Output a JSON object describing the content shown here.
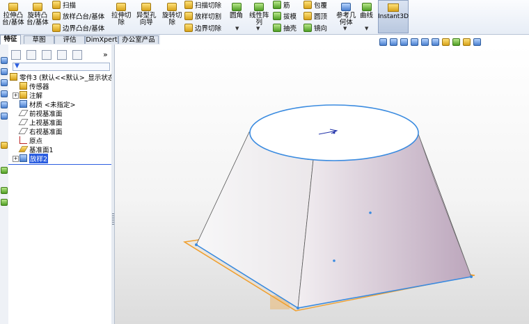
{
  "ribbon": {
    "extrude_boss": "拉伸凸\n台/基体",
    "revolve_boss": "旋转凸\n台/基体",
    "sweep": "扫描",
    "loft_boss": "放样凸台/基体",
    "boundary_boss": "边界凸台/基体",
    "extrude_cut": "拉伸切\n除",
    "hole_wizard": "异型孔\n向导",
    "revolve_cut": "旋转切\n除",
    "swept_cut": "扫描切除",
    "lofted_cut": "放样切割",
    "boundary_cut": "边界切除",
    "fillet": "圆角",
    "linear_pattern": "线性阵\n列",
    "rib": "筋",
    "draft": "拔模",
    "shell": "抽壳",
    "wrap": "包覆",
    "dome": "圆顶",
    "mirror": "镜向",
    "ref_geometry": "参考几\n何体",
    "curves": "曲线",
    "instant3d": "Instant3D"
  },
  "tabs": [
    "特征",
    "草图",
    "评估",
    "DimXpert",
    "办公室产品"
  ],
  "tree": {
    "root": "零件3 (默认<<默认>_显示状态 1",
    "items": [
      {
        "label": "传感器",
        "icon": "sensor-icon"
      },
      {
        "label": "注解",
        "icon": "annotation-icon"
      },
      {
        "label": "材质 <未指定>",
        "icon": "material-icon"
      },
      {
        "label": "前视基准面",
        "icon": "plane-icon"
      },
      {
        "label": "上视基准面",
        "icon": "plane-icon"
      },
      {
        "label": "右视基准面",
        "icon": "plane-icon"
      },
      {
        "label": "原点",
        "icon": "origin-icon"
      },
      {
        "label": "基准面1",
        "icon": "plane-icon"
      },
      {
        "label": "放样2",
        "icon": "loft-icon"
      }
    ],
    "collapse_label": "»"
  },
  "colors": {
    "accent": "#2c5ee0",
    "selection": "#2c5ee0",
    "plane_orange": "#f0a030",
    "edge_blue": "#3a8be0"
  }
}
